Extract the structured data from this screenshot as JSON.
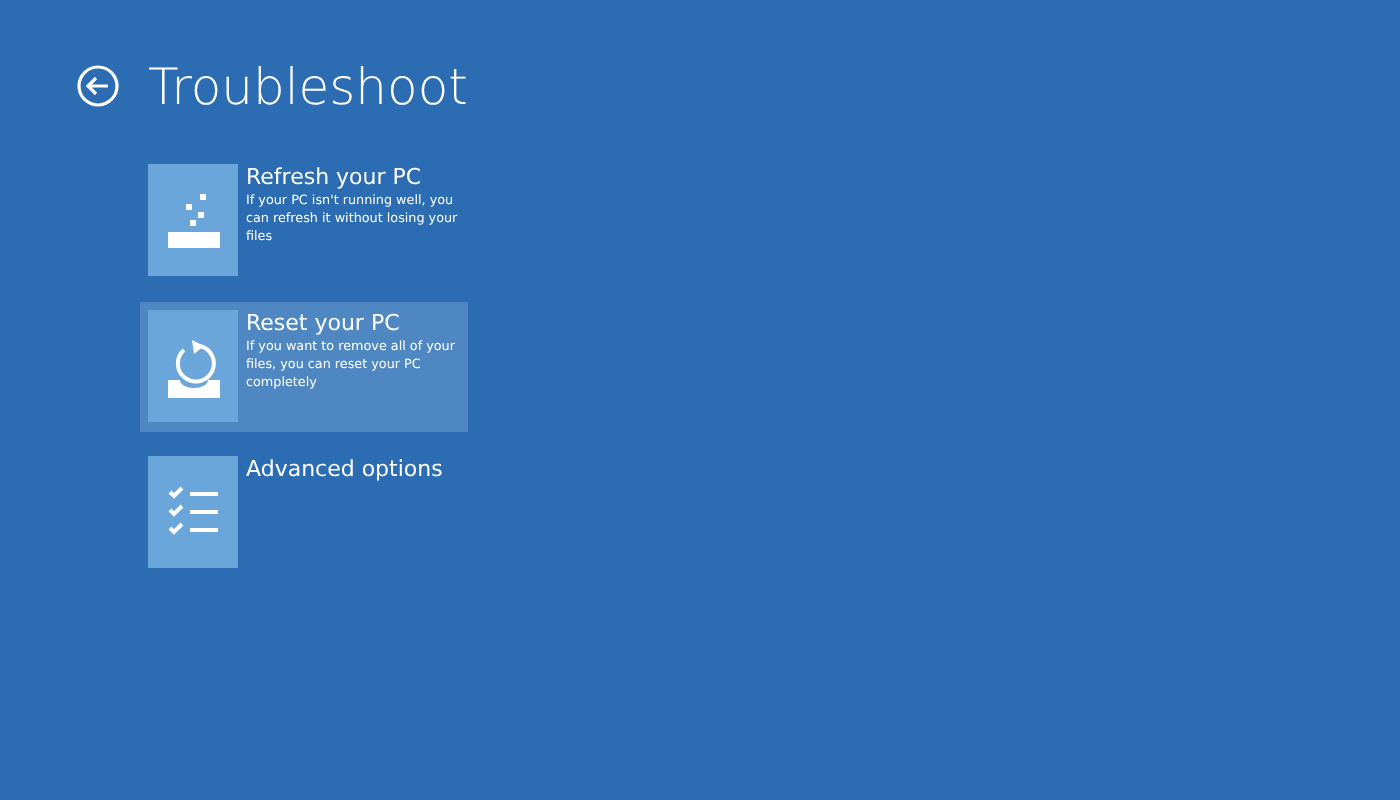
{
  "header": {
    "title": "Troubleshoot"
  },
  "options": [
    {
      "kind": "refresh",
      "title": "Refresh your PC",
      "description": "If your PC isn't running well, you can refresh it without losing your files",
      "selected": false
    },
    {
      "kind": "reset",
      "title": "Reset your PC",
      "description": "If you want to remove all of your files, you can reset your PC completely",
      "selected": true
    },
    {
      "kind": "advanced",
      "title": "Advanced options",
      "selected": false
    }
  ]
}
